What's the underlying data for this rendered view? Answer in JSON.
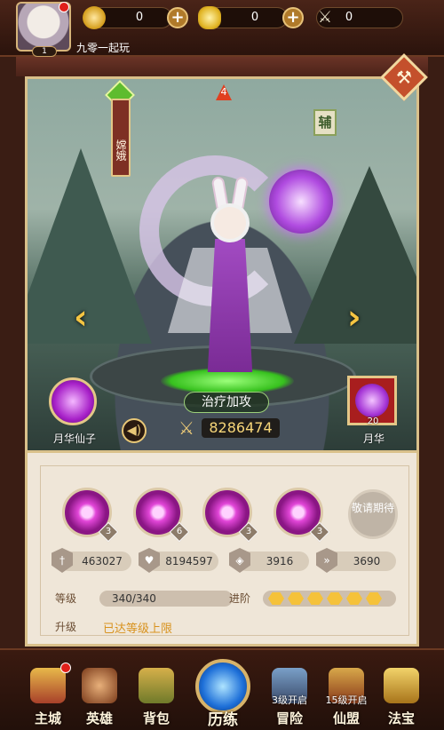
{
  "top_bar": {
    "player_level": "1",
    "player_name": "九零一起玩",
    "coins": "0",
    "ingots": "0",
    "swords": "0",
    "plus_label": "+"
  },
  "hero": {
    "name": "嫦娥",
    "star_badge": "4",
    "role": "辅",
    "skill_name": "治疗加攻",
    "power": "8286474",
    "prev_arrow": "‹",
    "next_arrow": "›",
    "fairy_label": "月华仙子",
    "item_label": "月华",
    "item_count": "20"
  },
  "skills": {
    "levels": [
      "3",
      "6",
      "3",
      "3"
    ],
    "locked_label": "敬请期待"
  },
  "stats": {
    "attack": "463027",
    "hp": "8194597",
    "defense": "3916",
    "speed": "3690"
  },
  "progress": {
    "level_label": "等级",
    "level_value": "340/340",
    "advance_label": "进阶",
    "advance_stars": 6,
    "upgrade_label": "升级",
    "upgrade_status": "已达等级上限"
  },
  "nav": {
    "main_city": "主城",
    "heroes": "英雄",
    "bag": "背包",
    "training": "历练",
    "adventure": "冒险",
    "adventure_lock": "3级开启",
    "alliance": "仙盟",
    "alliance_lock": "15级开启",
    "treasure": "法宝"
  },
  "colors": {
    "accent_gold": "#f5c23a",
    "panel_bg": "#efe6d8",
    "frame": "#3a1d14"
  }
}
